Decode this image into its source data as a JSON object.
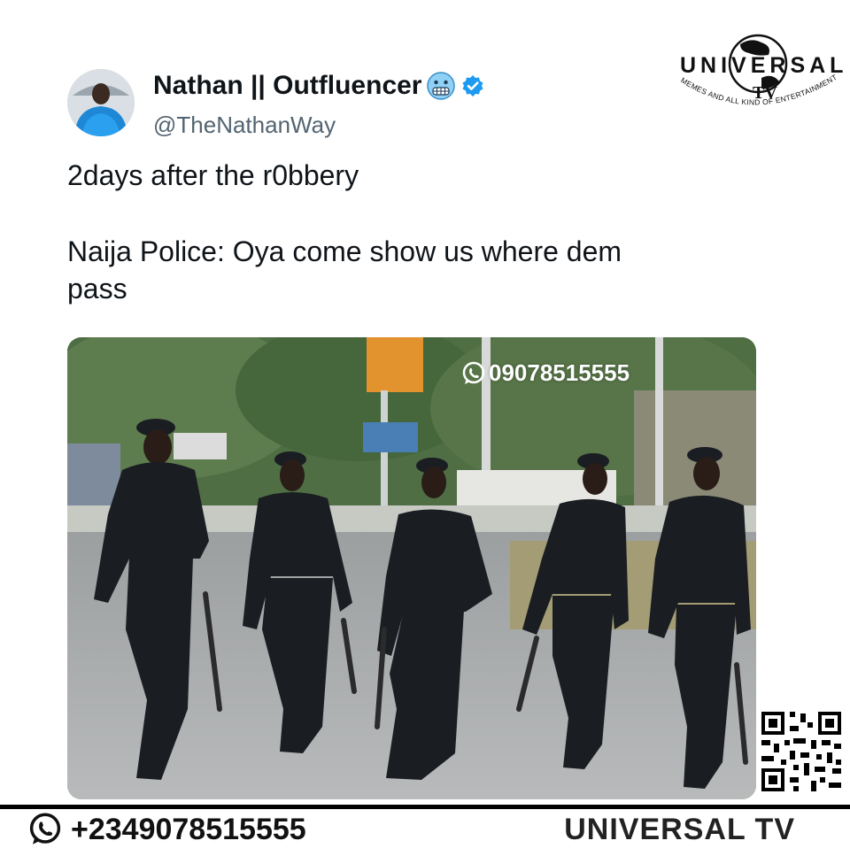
{
  "tweet": {
    "display_name": "Nathan || Outfluencer",
    "name_emoji": "cold-face-emoji",
    "verified_icon": "verified-badge-icon",
    "handle": "@TheNathanWay",
    "text_line1": "2days after the r0bbery",
    "text_line2": "Naija Police: Oya come show us where dem",
    "text_line3": "pass"
  },
  "media": {
    "watermark_phone": "09078515555"
  },
  "logo": {
    "word": "UNIVERSAL",
    "tv": "TV",
    "tagline": "MEMES AND ALL KIND OF ENTERTAINMENT"
  },
  "footer": {
    "phone": "+2349078515555",
    "brand": "UNIVERSAL TV"
  },
  "colors": {
    "verified_blue": "#1d9bf0",
    "handle_gray": "#536471",
    "text": "#0f1419"
  }
}
